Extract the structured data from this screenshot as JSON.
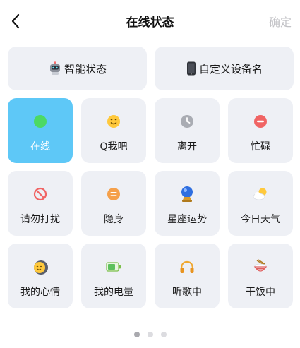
{
  "header": {
    "title": "在线状态",
    "confirm_label": "确定"
  },
  "top_buttons": [
    {
      "label": "智能状态",
      "icon": "robot-icon"
    },
    {
      "label": "自定义设备名",
      "icon": "phone-icon"
    }
  ],
  "status_grid": [
    {
      "label": "在线",
      "icon": "online-dot-icon",
      "selected": true
    },
    {
      "label": "Q我吧",
      "icon": "smile-icon"
    },
    {
      "label": "离开",
      "icon": "clock-icon"
    },
    {
      "label": "忙碌",
      "icon": "minus-circle-icon"
    },
    {
      "label": "请勿打扰",
      "icon": "no-entry-icon"
    },
    {
      "label": "隐身",
      "icon": "equal-circle-icon"
    },
    {
      "label": "星座运势",
      "icon": "crystal-ball-icon"
    },
    {
      "label": "今日天气",
      "icon": "weather-icon"
    },
    {
      "label": "我的心情",
      "icon": "mood-icon"
    },
    {
      "label": "我的电量",
      "icon": "battery-icon"
    },
    {
      "label": "听歌中",
      "icon": "headphones-icon"
    },
    {
      "label": "干饭中",
      "icon": "rice-bowl-icon"
    }
  ],
  "pagination": {
    "pages": 3,
    "current": 1
  },
  "colors": {
    "selected_tile": "#5ec8f7",
    "tile_bg": "#eef0f5",
    "online": "#4cd964",
    "busy": "#f06464"
  }
}
